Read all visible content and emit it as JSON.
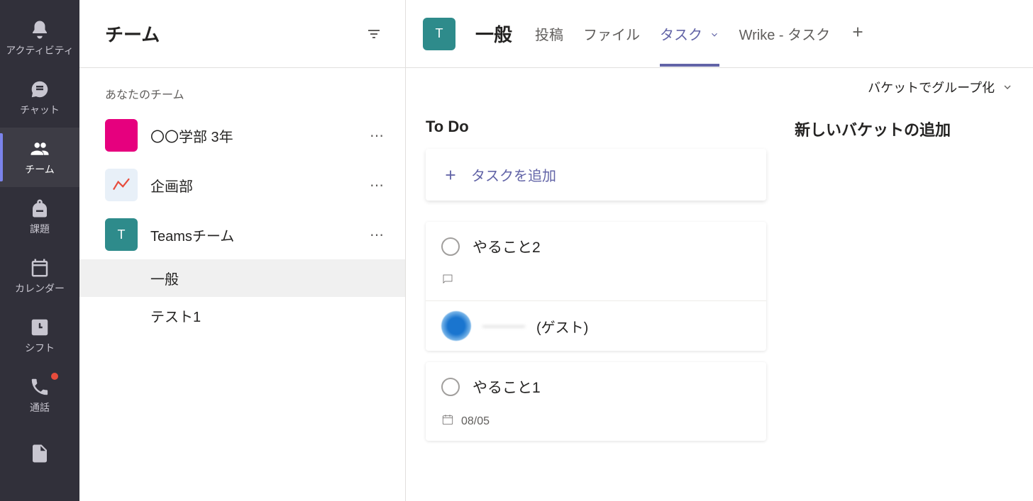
{
  "app_rail": {
    "items": [
      {
        "id": "activity",
        "label": "アクティビティ",
        "active": false
      },
      {
        "id": "chat",
        "label": "チャット",
        "active": false
      },
      {
        "id": "teams",
        "label": "チーム",
        "active": true
      },
      {
        "id": "assignments",
        "label": "課題",
        "active": false
      },
      {
        "id": "calendar",
        "label": "カレンダー",
        "active": false
      },
      {
        "id": "shifts",
        "label": "シフト",
        "active": false
      },
      {
        "id": "calls",
        "label": "通話",
        "active": false,
        "badge": true
      },
      {
        "id": "files",
        "label": "",
        "active": false
      }
    ]
  },
  "sidebar": {
    "title": "チーム",
    "section_label": "あなたのチーム",
    "teams": [
      {
        "name": "〇〇学部 3年",
        "color": "pink"
      },
      {
        "name": "企画部",
        "color": "chart"
      },
      {
        "name": "Teamsチーム",
        "color": "teal",
        "initial": "T",
        "channels": [
          {
            "name": "一般",
            "active": true
          },
          {
            "name": "テスト1",
            "active": false
          }
        ]
      }
    ]
  },
  "channel_header": {
    "avatar_initial": "T",
    "title": "一般",
    "tabs": [
      {
        "label": "投稿",
        "active": false
      },
      {
        "label": "ファイル",
        "active": false
      },
      {
        "label": "タスク",
        "active": true,
        "dropdown": true
      },
      {
        "label": "Wrike - タスク",
        "active": false
      }
    ]
  },
  "group_by": {
    "label": "バケットでグループ化"
  },
  "buckets": {
    "todo": {
      "title": "To Do",
      "add_task_label": "タスクを追加",
      "tasks": [
        {
          "title": "やること2",
          "has_comments": true,
          "assignee_name": "———",
          "assignee_suffix": "(ゲスト)"
        },
        {
          "title": "やること1",
          "due": "08/05"
        }
      ]
    },
    "new_bucket_label": "新しいバケットの追加"
  }
}
